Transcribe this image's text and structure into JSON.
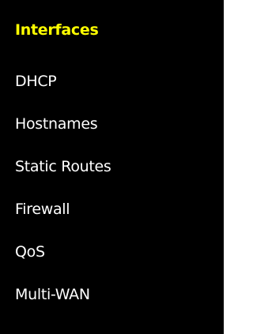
{
  "menu": {
    "items": [
      {
        "label": "Interfaces",
        "active": true
      },
      {
        "label": "DHCP",
        "active": false
      },
      {
        "label": "Hostnames",
        "active": false
      },
      {
        "label": "Static Routes",
        "active": false
      },
      {
        "label": "Firewall",
        "active": false
      },
      {
        "label": "QoS",
        "active": false
      },
      {
        "label": "Multi-WAN",
        "active": false
      }
    ],
    "colors": {
      "background": "#000000",
      "text": "#ffffff",
      "active_text": "#ffff00",
      "page_border": "#ffffff"
    }
  }
}
